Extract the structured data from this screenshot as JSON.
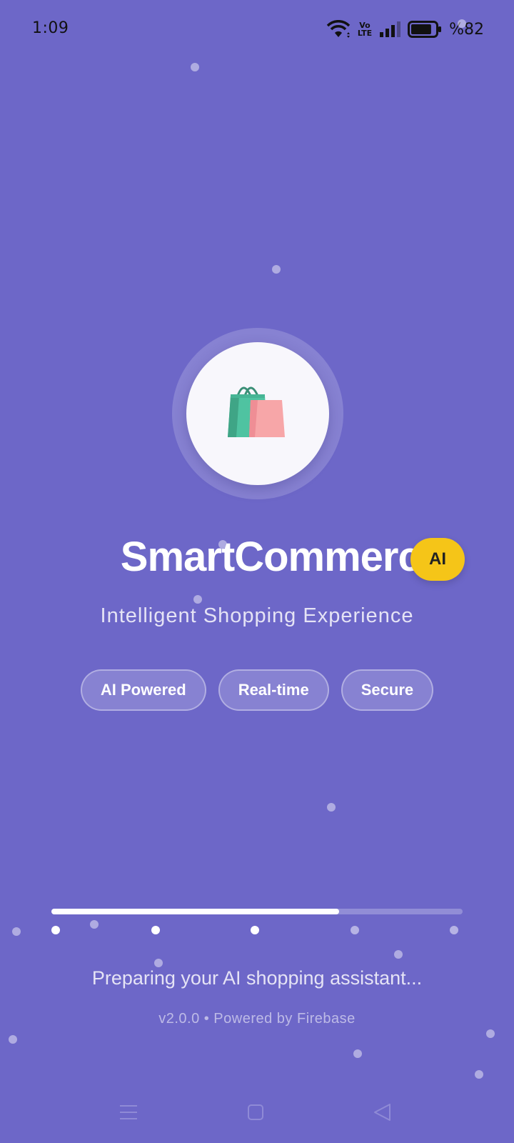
{
  "status_bar": {
    "time": "1:09",
    "network_badge_top": "Vo",
    "network_badge_bottom": "LTE",
    "battery_percent": "%82",
    "battery_level": 0.82
  },
  "splash": {
    "logo_icon": "shopping-bags-icon",
    "app_name": "SmartCommerce",
    "ai_badge": "AI",
    "tagline": "Intelligent Shopping Experience",
    "features": [
      "AI Powered",
      "Real-time",
      "Secure"
    ],
    "progress": 0.7,
    "loading_steps_total": 5,
    "loading_steps_done": 3,
    "loading_message": "Preparing your AI shopping assistant...",
    "version_line": "v2.0.0 • Powered by Firebase"
  },
  "navigation_bar": {
    "buttons": [
      "menu-icon",
      "home-square-icon",
      "back-triangle-icon"
    ]
  },
  "colors": {
    "background": "#6d67c8",
    "badge_yellow": "#f5c518",
    "bag_green": "#4fc3a1",
    "bag_pink": "#f7a6a8"
  }
}
